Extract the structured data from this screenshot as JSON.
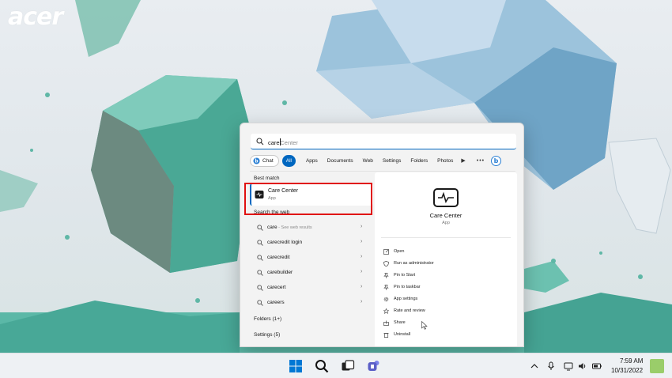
{
  "wallpaper": {
    "brand": "acer"
  },
  "search": {
    "query": "care",
    "suggestion": "Center"
  },
  "filters": {
    "chat": "Chat",
    "all": "All",
    "tabs": [
      "Apps",
      "Documents",
      "Web",
      "Settings",
      "Folders",
      "Photos"
    ],
    "more": "▶",
    "ellipsis": "•••"
  },
  "best_match": {
    "label": "Best match",
    "title": "Care Center",
    "type": "App"
  },
  "web_search": {
    "label": "Search the web",
    "items": [
      {
        "text": "care",
        "sub": " - See web results"
      },
      {
        "text": "carecredit login",
        "sub": ""
      },
      {
        "text": "carecredit",
        "sub": ""
      },
      {
        "text": "carebuilder",
        "sub": ""
      },
      {
        "text": "carecert",
        "sub": ""
      },
      {
        "text": "careers",
        "sub": ""
      }
    ]
  },
  "groups": {
    "folders": "Folders (1+)",
    "settings": "Settings (5)"
  },
  "details": {
    "title": "Care Center",
    "type": "App",
    "actions": [
      {
        "label": "Open",
        "icon": "open-icon"
      },
      {
        "label": "Run as administrator",
        "icon": "shield-icon"
      },
      {
        "label": "Pin to Start",
        "icon": "pin-icon"
      },
      {
        "label": "Pin to taskbar",
        "icon": "pin-icon"
      },
      {
        "label": "App settings",
        "icon": "gear-icon"
      },
      {
        "label": "Rate and review",
        "icon": "star-icon"
      },
      {
        "label": "Share",
        "icon": "share-icon"
      },
      {
        "label": "Uninstall",
        "icon": "trash-icon"
      }
    ]
  },
  "taskbar": {
    "time": "7:59 AM",
    "date": "10/31/2022",
    "accent": "#0067c0"
  },
  "colors": {
    "accent": "#0067c0",
    "highlight": "#e01010"
  }
}
